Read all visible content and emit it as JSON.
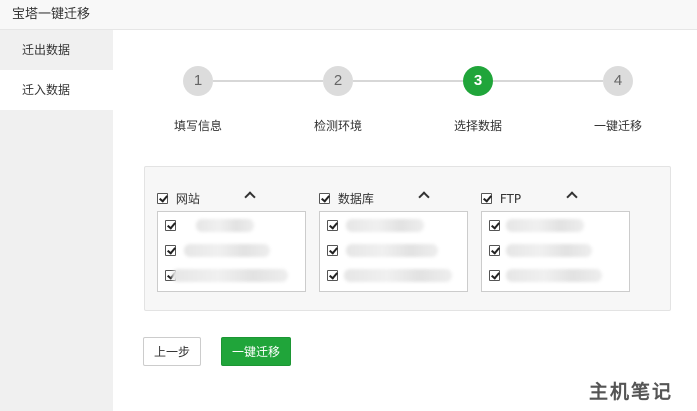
{
  "window": {
    "title": "宝塔一键迁移"
  },
  "sidebar": {
    "items": [
      {
        "label": "迁出数据",
        "active": false
      },
      {
        "label": "迁入数据",
        "active": true
      }
    ]
  },
  "steps": [
    {
      "number": "1",
      "label": "填写信息",
      "active": false
    },
    {
      "number": "2",
      "label": "检测环境",
      "active": false
    },
    {
      "number": "3",
      "label": "选择数据",
      "active": true
    },
    {
      "number": "4",
      "label": "一键迁移",
      "active": false
    }
  ],
  "panel": {
    "columns": [
      {
        "title": "网站",
        "checked": true,
        "rows": [
          true,
          true,
          true
        ]
      },
      {
        "title": "数据库",
        "checked": true,
        "rows": [
          true,
          true,
          true
        ]
      },
      {
        "title": "FTP",
        "checked": true,
        "rows": [
          true,
          true,
          true
        ]
      }
    ]
  },
  "buttons": {
    "prev_label": "上一步",
    "migrate_label": "一键迁移"
  },
  "watermark": {
    "text": "主机笔记"
  },
  "colors": {
    "accent": "#20a53a",
    "inactive_step": "#dcdcdc"
  }
}
